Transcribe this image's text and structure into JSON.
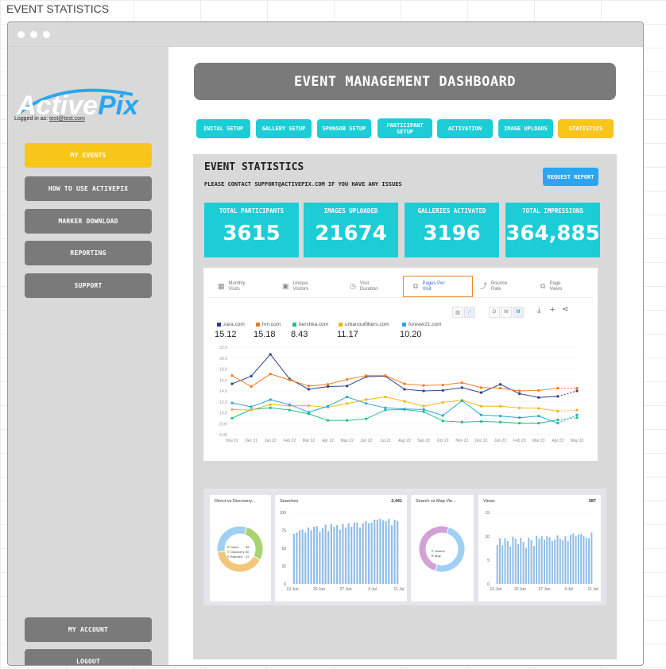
{
  "board_title": "EVENT STATISTICS",
  "logo": {
    "text_part1": "Active",
    "text_part2": "Pix"
  },
  "logged_in": {
    "label": "Logged in as:",
    "email": "test@test.com"
  },
  "sidebar": {
    "items": [
      {
        "label": "MY EVENTS",
        "active": true
      },
      {
        "label": "HOW TO USE ACTIVEPIX",
        "active": false
      },
      {
        "label": "MARKER DOWNLOAD",
        "active": false
      },
      {
        "label": "REPORTING",
        "active": false
      },
      {
        "label": "SUPPORT",
        "active": false
      }
    ],
    "bottom_items": [
      {
        "label": "MY ACCOUNT"
      },
      {
        "label": "LOGOUT"
      }
    ]
  },
  "header": {
    "title": "EVENT MANAGEMENT DASHBOARD"
  },
  "tabs": [
    {
      "label": "INITAL SETUP",
      "active": false
    },
    {
      "label": "GALLERY SETUP",
      "active": false
    },
    {
      "label": "SPONSOR SETUP",
      "active": false
    },
    {
      "label": "PARTICIPANT SETUP",
      "active": false
    },
    {
      "label": "ACTIVATION",
      "active": false
    },
    {
      "label": "IMAGE UPLOADS",
      "active": false
    },
    {
      "label": "STATISTICS",
      "active": true
    }
  ],
  "panel": {
    "title": "EVENT STATISTICS",
    "subtitle": "PLEASE CONTACT SUPPORT@ACTIVEPIX.COM IF YOU HAVE ANY ISSUES",
    "request_button": "REQUEST REPORT"
  },
  "stats": [
    {
      "label": "TOTAL PARTICIPANTS",
      "value": "3615"
    },
    {
      "label": "IMAGES UPLOADED",
      "value": "21674"
    },
    {
      "label": "GALLERIES ACTIVATED",
      "value": "3196"
    },
    {
      "label": "TOTAL IMPRESSIONS",
      "value": "364,885"
    }
  ],
  "metric_tabs": [
    {
      "label": "Monthly Visits",
      "icon": "calendar-icon",
      "active": false
    },
    {
      "label": "Unique Visitors",
      "icon": "user-card-icon",
      "active": false
    },
    {
      "label": "Visit Duration",
      "icon": "clock-icon",
      "active": false
    },
    {
      "label": "Pages Per Visit",
      "icon": "pages-icon",
      "active": true
    },
    {
      "label": "Bounce Rate",
      "icon": "bounce-icon",
      "active": false
    },
    {
      "label": "Page Views",
      "icon": "page-views-icon",
      "active": false
    }
  ],
  "chart_toolbar": {
    "granularity": [
      "D",
      "W",
      "M"
    ],
    "selected": "M"
  },
  "chart_data": [
    {
      "type": "line",
      "x": [
        "Nov 21",
        "Dec 21",
        "Jan 22",
        "Feb 22",
        "Mar 22",
        "Apr 22",
        "May 22",
        "Jun 22",
        "Jul 22",
        "Aug 22",
        "Sep 22",
        "Oct 22",
        "Nov 22",
        "Dec 22",
        "Jan 23",
        "Feb 23",
        "Mar 23",
        "Apr 23",
        "May 23"
      ],
      "ylim": [
        6,
        22
      ],
      "yticks": [
        "6.00",
        "8.00",
        "10.0",
        "12.0",
        "14.0",
        "16.0",
        "18.0",
        "20.0",
        "22.0"
      ],
      "series": [
        {
          "name": "zara.com",
          "color": "#2b3f8c",
          "legend_value": "15.12",
          "values": [
            15.3,
            16.7,
            20.7,
            16.2,
            14.3,
            14.8,
            14.9,
            16.6,
            16.7,
            14.3,
            14.0,
            14.1,
            14.6,
            13.7,
            15.2,
            13.5,
            12.8,
            13.0,
            14.0
          ]
        },
        {
          "name": "hm.com",
          "color": "#f47b20",
          "legend_value": "15.18",
          "values": [
            16.8,
            14.8,
            17.1,
            16.0,
            14.9,
            15.2,
            16.1,
            16.8,
            16.8,
            15.3,
            15.0,
            15.1,
            15.5,
            14.6,
            14.5,
            14.0,
            14.1,
            14.5,
            14.5
          ]
        },
        {
          "name": "bershka.com",
          "color": "#1cbf8a",
          "legend_value": "8.43",
          "values": [
            9.0,
            10.6,
            10.9,
            10.5,
            9.8,
            8.6,
            8.6,
            8.9,
            10.5,
            10.6,
            10.2,
            8.5,
            8.3,
            8.4,
            8.3,
            8.1,
            8.1,
            8.7,
            9.1
          ]
        },
        {
          "name": "urbanoutfitters.com",
          "color": "#f6b21c",
          "legend_value": "11.17",
          "values": [
            10.6,
            10.5,
            11.5,
            11.3,
            11.3,
            11.0,
            11.7,
            12.4,
            12.9,
            12.1,
            11.2,
            11.9,
            12.3,
            11.2,
            11.2,
            10.9,
            10.8,
            10.3,
            10.5
          ]
        },
        {
          "name": "forever21.com",
          "color": "#2aa6d9",
          "legend_value": "10.20",
          "values": [
            11.8,
            11.1,
            12.4,
            11.5,
            10.1,
            11.2,
            12.9,
            11.7,
            10.9,
            10.7,
            10.6,
            9.5,
            12.2,
            9.6,
            9.4,
            9.1,
            9.4,
            8.1,
            9.6
          ]
        }
      ]
    },
    {
      "type": "pie",
      "title": "Direct vs Discovery...",
      "series": [
        {
          "name": "Direct",
          "value": 28
        },
        {
          "name": "Discovery",
          "value": 40
        },
        {
          "name": "Branded",
          "value": 32
        }
      ],
      "legend_values": [
        "98",
        "50",
        "22"
      ],
      "colors": [
        "#a8d370",
        "#f2c77a",
        "#9fd0f3"
      ]
    },
    {
      "type": "bar",
      "title": "Searches",
      "total": "2,441",
      "ylim": [
        0,
        100
      ],
      "yticks": [
        "0",
        "25",
        "50",
        "75",
        "100"
      ],
      "xticks": [
        "13 Jun",
        "20 Jun",
        "27 Jun",
        "4 Jul",
        "11 Jul"
      ],
      "values": [
        70,
        72,
        75,
        76,
        72,
        79,
        75,
        80,
        81,
        73,
        78,
        83,
        74,
        84,
        80,
        82,
        76,
        84,
        79,
        85,
        80,
        86,
        86,
        79,
        85,
        88,
        85,
        86,
        90,
        90,
        91,
        89,
        88,
        91,
        82,
        90,
        88
      ]
    },
    {
      "type": "pie",
      "title": "Search vs Map Vie...",
      "series": [
        {
          "name": "Search",
          "value": 50
        },
        {
          "name": "Map",
          "value": 50
        }
      ],
      "colors": [
        "#9fd0f3",
        "#d2a2d6"
      ]
    },
    {
      "type": "bar",
      "title": "Views",
      "total": "287",
      "ylim": [
        0,
        15
      ],
      "yticks": [
        "0",
        "5",
        "10",
        "15"
      ],
      "xticks": [
        "13 Jun",
        "20 Jun",
        "27 Jun",
        "4 Jul",
        "11 Jul"
      ],
      "values": [
        8.2,
        9.6,
        8.1,
        9.6,
        9.0,
        7.9,
        9.9,
        9.5,
        8.4,
        9.7,
        8.8,
        7.6,
        9.7,
        9.2,
        8.0,
        10.1,
        9.5,
        10.0,
        9.3,
        10.0,
        9.8,
        9.0,
        9.3,
        10.2,
        9.5,
        9.2,
        10.0,
        9.0,
        10.3,
        10.6,
        10.1,
        10.4,
        10.5,
        10.1,
        9.7,
        9.6,
        10.8
      ]
    }
  ]
}
